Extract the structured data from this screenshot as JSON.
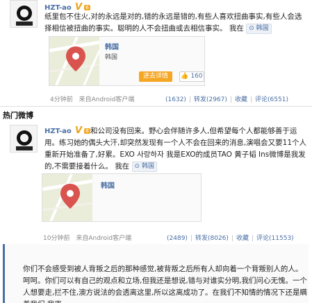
{
  "post1": {
    "username": "HZT-ao",
    "badge": "V",
    "level": "6",
    "text": "纸里包不住火,对的永远是对的,错的永远是错的,有些人喜欢扭曲事实,有些人会选择相信被扭曲的事实。聪明的人不会扭曲或去相信事实。",
    "location_prefix": "我在",
    "location": "韩国",
    "card_title": "韩国",
    "card_sub": "韩国",
    "detail_btn": "进去详情",
    "like_count": "160",
    "time": "4分钟前",
    "source": "来自Android客户端",
    "actions": [
      "(1632)",
      "转发(2967)",
      "收藏",
      "评论(6551)"
    ]
  },
  "section_title": "热门微博",
  "post2": {
    "username": "HZT-ao",
    "badge": "V",
    "level": "6",
    "text": "和公司没有回来。野心会伴随许多人,但希望每个人都能够善于运用。练习她的偶头大汗,却突然发现有一个人不会在回来的消息,演唱会又要11个人重新开始准备了,好累。EXO 사랑하자 我是EXO的成员TAO 黄子韬 Ins微博是我发的,不需要接着什么。",
    "location_prefix": "我在",
    "location": "韩国",
    "card_title": "韩国",
    "time": "10分钟前",
    "source": "来自Android客户端",
    "actions": [
      "(2489)",
      "转发(8026)",
      "收藏",
      "评论(11553)"
    ]
  },
  "quote": {
    "text": "你们不会感受到被人背叛之后的那种感觉,被背叛之后所有人却向着一个背叛别人的人。呵呵。你们可以有自己的观点和立场,但我还是想说,错与对谁实分明,我们问心无愧。一个人想要走,拦不住,澳方说法的会透离这里,所以这离成功了。在我们不知情的情况下还是瞒着我们,我离"
  },
  "colors": {
    "link": "#4a6fa5",
    "accent": "#f5a623",
    "pin": "#d9534f"
  },
  "icons": [
    "map-pin-icon",
    "location-icon",
    "thumbs-up-icon"
  ]
}
